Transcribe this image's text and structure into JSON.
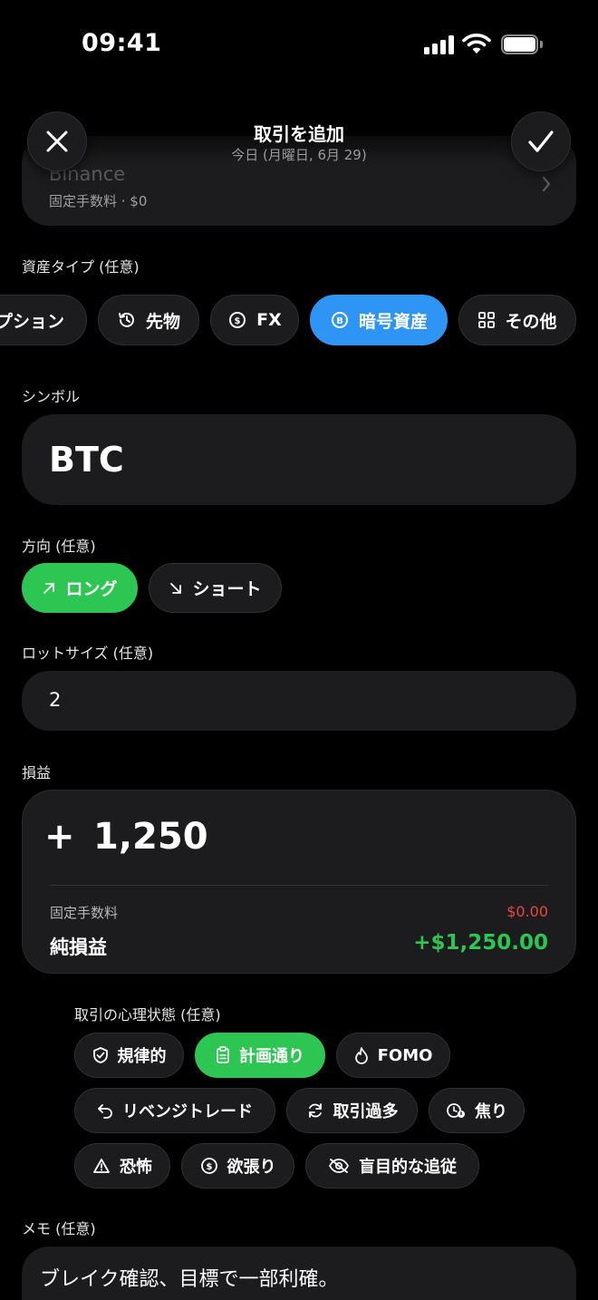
{
  "status_bar": {
    "time": "09:41"
  },
  "header": {
    "title": "取引を追加",
    "subtitle": "今日 (月曜日, 6月 29)"
  },
  "broker": {
    "name": "Binance",
    "fee_info": "固定手数料 · $0"
  },
  "asset_type": {
    "label": "資産タイプ (任意)",
    "options": [
      {
        "label": "プション",
        "icon": "partial-chip"
      },
      {
        "label": "先物",
        "icon": "clock-history-icon"
      },
      {
        "label": "FX",
        "icon": "currency-exchange-icon"
      },
      {
        "label": "暗号資産",
        "icon": "bitcoin-icon",
        "selected": true
      },
      {
        "label": "その他",
        "icon": "grid-icon"
      }
    ]
  },
  "symbol": {
    "label": "シンボル",
    "value": "BTC"
  },
  "direction": {
    "label": "方向 (任意)",
    "long": "ロング",
    "short": "ショート",
    "selected": "long"
  },
  "lot_size": {
    "label": "ロットサイズ (任意)",
    "value": "2"
  },
  "pnl": {
    "label": "損益",
    "sign": "+",
    "amount": "1,250",
    "fee_label": "固定手数料",
    "fee_value": "$0.00",
    "net_label": "純損益",
    "net_value": "+$1,250.00"
  },
  "emotions": {
    "label": "取引の心理状態 (任意)",
    "options": [
      {
        "label": "規律的",
        "icon": "shield-check-icon"
      },
      {
        "label": "計画通り",
        "icon": "clipboard-icon",
        "selected": true
      },
      {
        "label": "FOMO",
        "icon": "flame-icon"
      },
      {
        "label": "リベンジトレード",
        "icon": "undo-arrow-icon"
      },
      {
        "label": "取引過多",
        "icon": "refresh-icon"
      },
      {
        "label": "焦り",
        "icon": "clock-alert-icon"
      },
      {
        "label": "恐怖",
        "icon": "warning-icon"
      },
      {
        "label": "欲張り",
        "icon": "dollar-circle-icon"
      },
      {
        "label": "盲目的な追従",
        "icon": "eye-off-icon"
      }
    ]
  },
  "memo": {
    "label": "メモ (任意)",
    "value": "ブレイク確認、目標で一部利確。"
  },
  "colors": {
    "accent_blue": "#2f95f5",
    "positive_green": "#2dc653",
    "negative_red": "#e5483d",
    "surface": "#1c1c1e"
  }
}
